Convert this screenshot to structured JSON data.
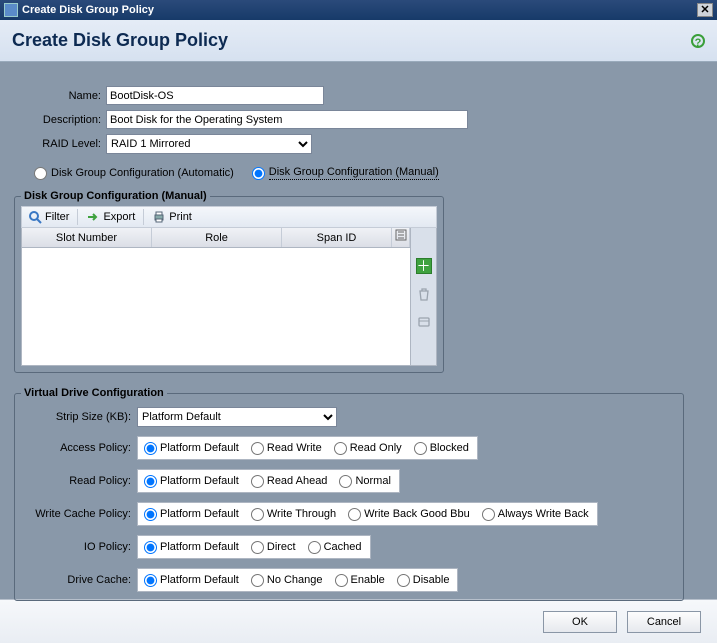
{
  "window": {
    "title": "Create Disk Group Policy"
  },
  "header": {
    "title": "Create Disk Group Policy"
  },
  "fields": {
    "name_label": "Name:",
    "name_value": "BootDisk-OS",
    "desc_label": "Description:",
    "desc_value": "Boot Disk for the Operating System",
    "raid_label": "RAID Level:",
    "raid_value": "RAID 1 Mirrored"
  },
  "config_mode": {
    "automatic": "Disk Group Configuration (Automatic)",
    "manual": "Disk Group Configuration (Manual)",
    "selected": "manual"
  },
  "manual_group": {
    "legend": "Disk Group Configuration (Manual)",
    "toolbar": {
      "filter": "Filter",
      "export": "Export",
      "print": "Print"
    },
    "columns": [
      "Slot Number",
      "Role",
      "Span ID"
    ]
  },
  "vdc": {
    "legend": "Virtual Drive Configuration",
    "strip_label": "Strip Size (KB):",
    "strip_value": "Platform Default",
    "access_label": "Access Policy:",
    "access_options": [
      "Platform Default",
      "Read Write",
      "Read Only",
      "Blocked"
    ],
    "read_label": "Read Policy:",
    "read_options": [
      "Platform Default",
      "Read Ahead",
      "Normal"
    ],
    "write_label": "Write Cache Policy:",
    "write_options": [
      "Platform Default",
      "Write Through",
      "Write Back Good Bbu",
      "Always Write Back"
    ],
    "io_label": "IO Policy:",
    "io_options": [
      "Platform Default",
      "Direct",
      "Cached"
    ],
    "drive_label": "Drive Cache:",
    "drive_options": [
      "Platform Default",
      "No Change",
      "Enable",
      "Disable"
    ]
  },
  "footer": {
    "ok": "OK",
    "cancel": "Cancel"
  }
}
